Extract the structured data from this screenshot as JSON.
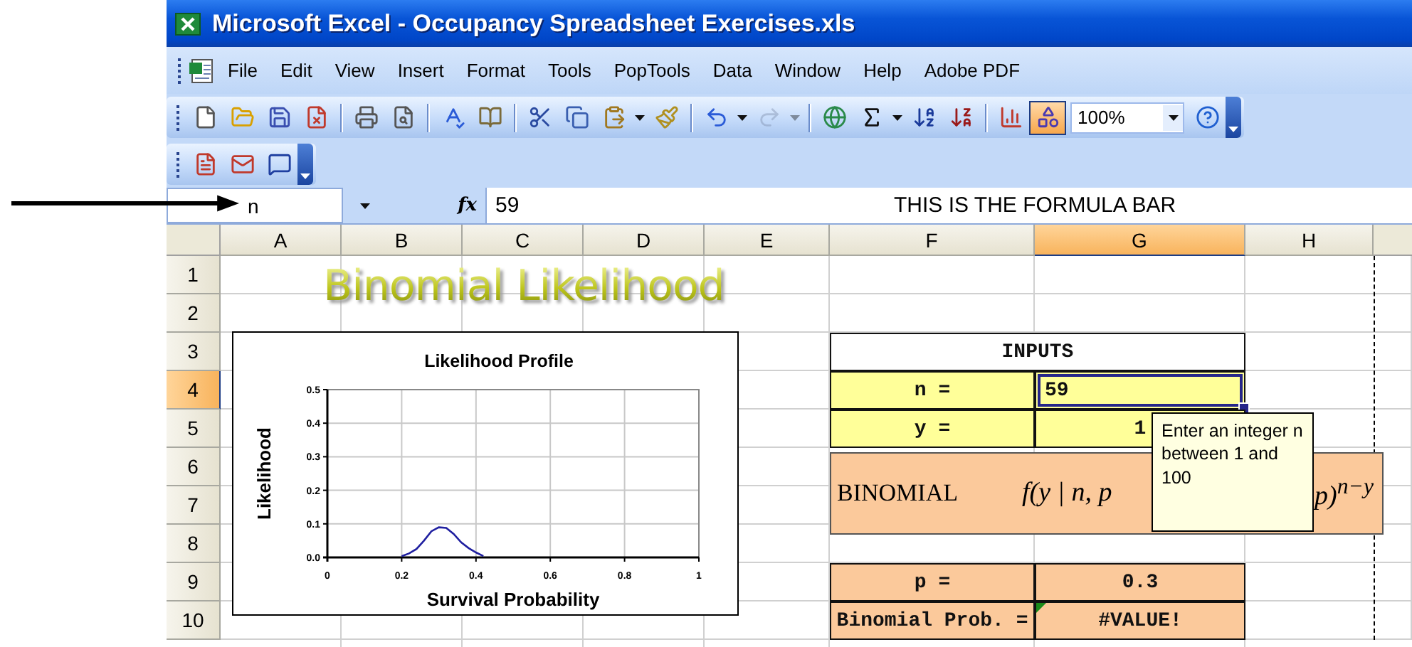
{
  "window": {
    "title": "Microsoft Excel - Occupancy Spreadsheet Exercises.xls"
  },
  "menu": [
    "File",
    "Edit",
    "View",
    "Insert",
    "Format",
    "Tools",
    "PopTools",
    "Data",
    "Window",
    "Help",
    "Adobe PDF"
  ],
  "standard_toolbar": [
    {
      "kind": "new",
      "pressed": false,
      "disabled": false
    },
    {
      "kind": "open",
      "pressed": false,
      "disabled": false
    },
    {
      "kind": "save",
      "pressed": false,
      "disabled": false
    },
    {
      "kind": "permission",
      "pressed": false,
      "disabled": false
    },
    {
      "kind": "separator"
    },
    {
      "kind": "print",
      "pressed": false,
      "disabled": false
    },
    {
      "kind": "preview",
      "pressed": false,
      "disabled": false
    },
    {
      "kind": "separator"
    },
    {
      "kind": "spelling",
      "pressed": false,
      "disabled": false
    },
    {
      "kind": "research",
      "pressed": false,
      "disabled": false
    },
    {
      "kind": "separator"
    },
    {
      "kind": "cut",
      "pressed": false,
      "disabled": false
    },
    {
      "kind": "copy",
      "pressed": false,
      "disabled": false
    },
    {
      "kind": "paste",
      "pressed": false,
      "disabled": false
    },
    {
      "kind": "dropdown",
      "disabled": false
    },
    {
      "kind": "format-painter",
      "pressed": false,
      "disabled": false
    },
    {
      "kind": "separator"
    },
    {
      "kind": "undo",
      "pressed": false,
      "disabled": false
    },
    {
      "kind": "dropdown",
      "disabled": false
    },
    {
      "kind": "redo",
      "pressed": false,
      "disabled": true
    },
    {
      "kind": "dropdown",
      "disabled": true
    },
    {
      "kind": "separator"
    },
    {
      "kind": "hyperlink",
      "pressed": false,
      "disabled": false
    },
    {
      "kind": "autosum",
      "pressed": false,
      "disabled": false
    },
    {
      "kind": "dropdown",
      "disabled": false
    },
    {
      "kind": "sort-ascending",
      "pressed": false,
      "disabled": false
    },
    {
      "kind": "sort-descending",
      "pressed": false,
      "disabled": false
    },
    {
      "kind": "separator"
    },
    {
      "kind": "chart",
      "pressed": false,
      "disabled": false
    },
    {
      "kind": "drawing",
      "pressed": true,
      "disabled": false
    },
    {
      "kind": "zoom",
      "value": "100%"
    },
    {
      "kind": "help",
      "pressed": false,
      "disabled": false
    }
  ],
  "pdf_toolbar": [
    {
      "kind": "pdf-convert"
    },
    {
      "kind": "pdf-email"
    },
    {
      "kind": "pdf-review"
    }
  ],
  "formula_bar": {
    "name_box": "n",
    "function_label": "fx",
    "formula": "59",
    "annotation": "THIS IS THE FORMULA BAR"
  },
  "sheet": {
    "columns": [
      {
        "label": "A",
        "selected": false
      },
      {
        "label": "B",
        "selected": false
      },
      {
        "label": "C",
        "selected": false
      },
      {
        "label": "D",
        "selected": false
      },
      {
        "label": "E",
        "selected": false
      },
      {
        "label": "F",
        "selected": false
      },
      {
        "label": "G",
        "selected": true
      },
      {
        "label": "H",
        "selected": false
      }
    ],
    "rows": [
      {
        "label": "1",
        "selected": false
      },
      {
        "label": "2",
        "selected": false
      },
      {
        "label": "3",
        "selected": false
      },
      {
        "label": "4",
        "selected": true
      },
      {
        "label": "5",
        "selected": false
      },
      {
        "label": "6",
        "selected": false
      },
      {
        "label": "7",
        "selected": false
      },
      {
        "label": "8",
        "selected": false
      },
      {
        "label": "9",
        "selected": false
      },
      {
        "label": "10",
        "selected": false
      }
    ],
    "title_art": "Binomial Likelihood",
    "inputs": {
      "title": "INPUTS",
      "rows": [
        {
          "label": "n =",
          "value": "59",
          "selected": true
        },
        {
          "label": "y =",
          "value": "1",
          "selected": false
        }
      ]
    },
    "formula_box": {
      "label": "BINOMIAL",
      "formula_left": "f(y | n, p",
      "formula_right": "p)$^{n−y}$"
    },
    "results": [
      {
        "label": "p =",
        "value": "0.3",
        "error": false
      },
      {
        "label": "Binomial Prob. =",
        "value": "#VALUE!",
        "error": true
      }
    ],
    "tooltip": "Enter an integer n between 1 and 100",
    "chart": {
      "chart_data": {
        "type": "line",
        "title": "Likelihood Profile",
        "xlabel": "Survival Probability",
        "ylabel": "Likelihood",
        "x": [
          0.2,
          0.22,
          0.24,
          0.26,
          0.28,
          0.3,
          0.32,
          0.34,
          0.36,
          0.38,
          0.4,
          0.42
        ],
        "grid": true,
        "series": [
          {
            "color": "#1f1fa0",
            "values": [
              0.004,
              0.012,
              0.025,
              0.05,
              0.078,
              0.09,
              0.088,
              0.07,
              0.045,
              0.028,
              0.015,
              0.004
            ]
          }
        ],
        "xlim": [
          0,
          1
        ],
        "ylim": [
          0,
          0.5
        ],
        "xticks": [
          {
            "value": 0,
            "label": "0"
          },
          {
            "value": 0.2,
            "label": "0.2"
          },
          {
            "value": 0.4,
            "label": "0.4"
          },
          {
            "value": 0.6,
            "label": "0.6"
          },
          {
            "value": 0.8,
            "label": "0.8"
          },
          {
            "value": 1,
            "label": "1"
          }
        ],
        "yticks": [
          {
            "value": 0,
            "label": "0.0"
          },
          {
            "value": 0.1,
            "label": "0.1"
          },
          {
            "value": 0.2,
            "label": "0.2"
          },
          {
            "value": 0.3,
            "label": "0.3"
          },
          {
            "value": 0.4,
            "label": "0.4"
          },
          {
            "value": 0.5,
            "label": "0.5"
          }
        ]
      }
    }
  }
}
